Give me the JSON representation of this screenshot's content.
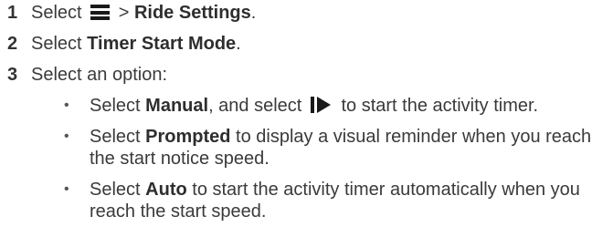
{
  "steps": [
    {
      "num": "1",
      "pre": "Select ",
      "icon": "menu-icon",
      "mid": " > ",
      "bold": "Ride Settings",
      "post": "."
    },
    {
      "num": "2",
      "pre": "Select ",
      "bold": "Timer Start Mode",
      "post": "."
    },
    {
      "num": "3",
      "text": "Select an option:"
    }
  ],
  "options": [
    {
      "pre": "Select ",
      "bold": "Manual",
      "mid": ", and select ",
      "icon": "start-play-icon",
      "post": " to start the activity timer."
    },
    {
      "pre": "Select ",
      "bold": "Prompted",
      "post": " to display a visual reminder when you reach the start notice speed."
    },
    {
      "pre": "Select ",
      "bold": "Auto",
      "post": " to start the activity timer automatically when you reach the start speed."
    }
  ],
  "bullet_char": "•"
}
